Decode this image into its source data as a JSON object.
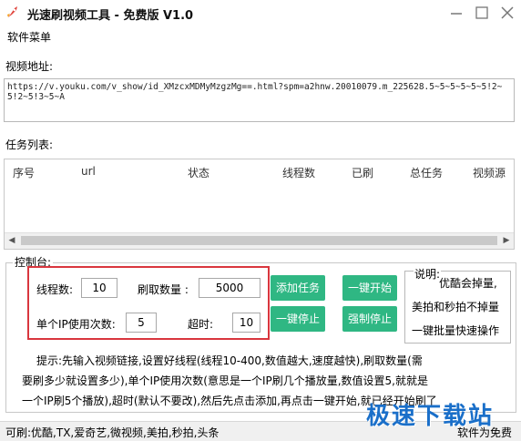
{
  "window": {
    "title": "光速刷视频工具 - 免费版 V1.0",
    "controls": {
      "minimize": "minimize-icon",
      "maximize": "maximize-icon",
      "close": "close-icon"
    }
  },
  "menu": {
    "software_menu": "软件菜单"
  },
  "video_url": {
    "label": "视频地址:",
    "value": "https://v.youku.com/v_show/id_XMzcxMDMyMzgzMg==.html?spm=a2hnw.20010079.m_225628.5~5~5~5~5~5!2~5!2~5!3~5~A"
  },
  "task_list": {
    "label": "任务列表:",
    "columns": [
      "序号",
      "url",
      "状态",
      "线程数",
      "已刷",
      "总任务",
      "视频源"
    ]
  },
  "control": {
    "legend": "控制台:",
    "threads_label": "线程数:",
    "threads_value": "10",
    "count_label": "刷取数量 :",
    "count_value": "5000",
    "per_ip_label": "单个IP使用次数:",
    "per_ip_value": "5",
    "timeout_label": "超时:",
    "timeout_value": "10",
    "buttons": {
      "add_task": "添加任务",
      "one_click_start": "一键开始",
      "one_click_stop": "一键停止",
      "force_stop": "强制停止"
    },
    "info": {
      "legend": "说明:",
      "lines": [
        "优酷会掉量,",
        "美拍和秒拍不掉量",
        "一键批量快速操作"
      ]
    },
    "hint_lines": [
      "提示:先输入视频链接,设置好线程(线程10-400,数值越大,速度越快),刷取数量(需",
      "要刷多少就设置多少),单个IP使用次数(意思是一个IP刷几个播放量,数值设置5,就就是",
      "一个IP刷5个播放),超时(默认不要改),然后先点击添加,再点击一键开始,就已经开始刷了"
    ]
  },
  "status_bar": {
    "supported": "可刷:优酷,TX,爱奇艺,微视频,美拍,秒拍,头条",
    "license": "软件为免费"
  },
  "watermark": {
    "text": "极速下载站"
  },
  "colors": {
    "accent_green": "#2fb783",
    "highlight_red": "#d9363e",
    "watermark_blue": "#1a6fc9"
  }
}
